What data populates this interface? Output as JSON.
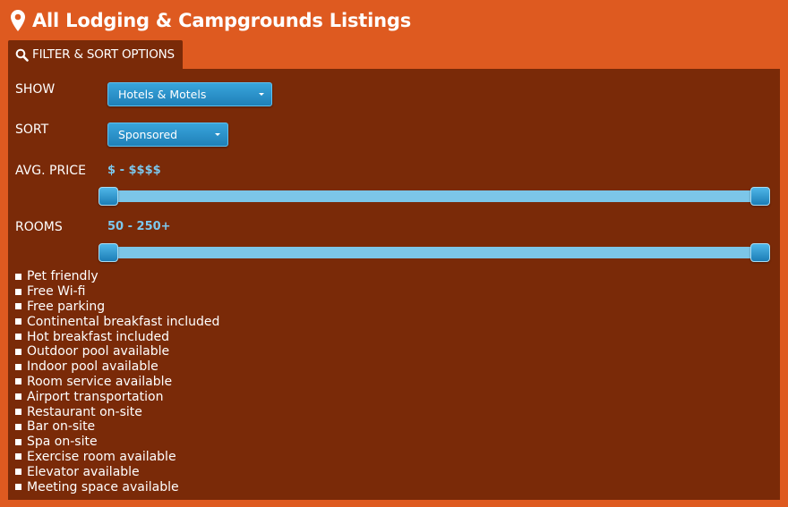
{
  "header": {
    "title": "All Lodging & Campgrounds Listings",
    "icon": "map-pin-icon"
  },
  "tab": {
    "label": "FILTER & SORT OPTIONS",
    "icon": "search-icon"
  },
  "show": {
    "label": "SHOW",
    "selected": "Hotels & Motels"
  },
  "sort": {
    "label": "SORT",
    "selected": "Sponsored"
  },
  "price": {
    "label": "AVG. PRICE",
    "value_text": "$ - $$$$",
    "range": [
      0,
      1
    ]
  },
  "rooms": {
    "label": "ROOMS",
    "value_text": "50 - 250+",
    "range": [
      0,
      1
    ]
  },
  "amenities": [
    "Pet friendly",
    "Free Wi-fi",
    "Free parking",
    "Continental breakfast included",
    "Hot breakfast included",
    "Outdoor pool available",
    "Indoor pool available",
    "Room service available",
    "Airport transportation",
    "Restaurant on-site",
    "Bar on-site",
    "Spa on-site",
    "Exercise room available",
    "Elevator available",
    "Meeting space available"
  ],
  "colors": {
    "page_bg": "#de5a20",
    "panel_bg": "#7a2a08",
    "control_blue": "#1f80b8",
    "value_blue": "#7cc8ee"
  }
}
